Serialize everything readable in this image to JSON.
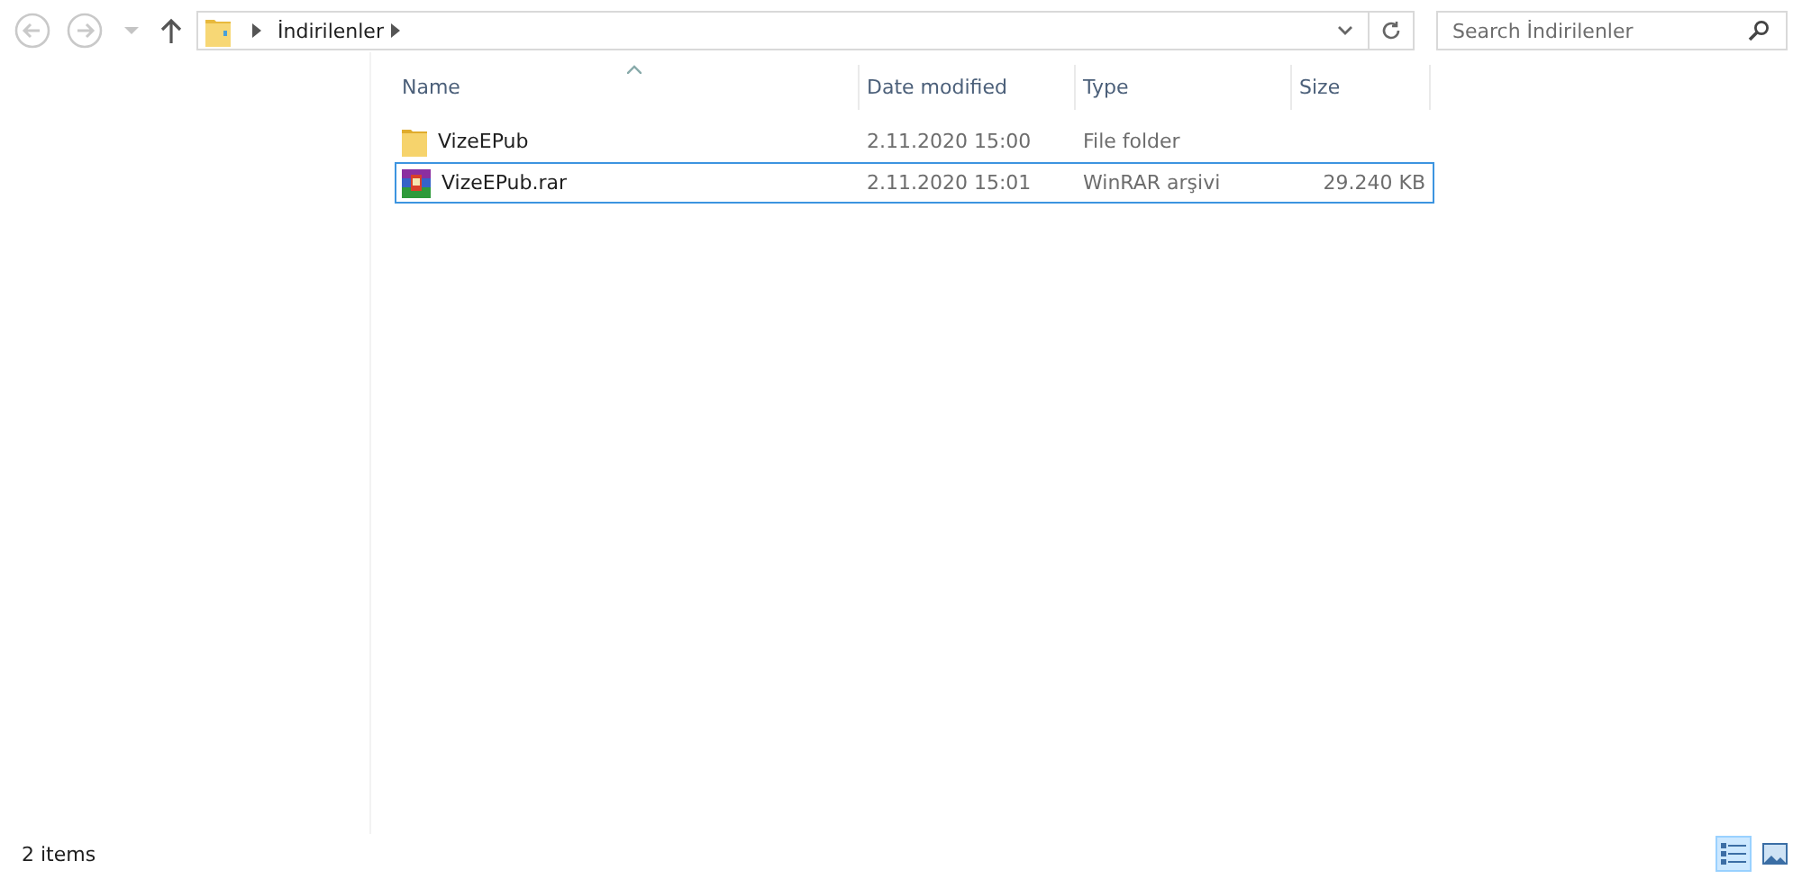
{
  "address_bar": {
    "breadcrumbs": [
      {
        "label": "İndirilenler"
      }
    ]
  },
  "search": {
    "placeholder": "Search İndirilenler"
  },
  "file_list": {
    "columns": [
      {
        "label": "Name",
        "sorted": true
      },
      {
        "label": "Date modified",
        "sorted": false
      },
      {
        "label": "Type",
        "sorted": false
      },
      {
        "label": "Size",
        "sorted": false
      }
    ],
    "rows": [
      {
        "kind": "folder",
        "name": "VizeEPub",
        "date": "2.11.2020 15:00",
        "type": "File folder",
        "focused": false
      },
      {
        "kind": "archive",
        "name": "VizeEPub.rar",
        "date": "2.11.2020 15:01",
        "type": "WinRAR arşivi",
        "size": "29.240 KB",
        "focused": true
      }
    ]
  },
  "status_bar": {
    "item_count": "2 items",
    "views": [
      {
        "kind": "details",
        "selected": true
      },
      {
        "kind": "large-icons",
        "selected": false
      }
    ]
  }
}
